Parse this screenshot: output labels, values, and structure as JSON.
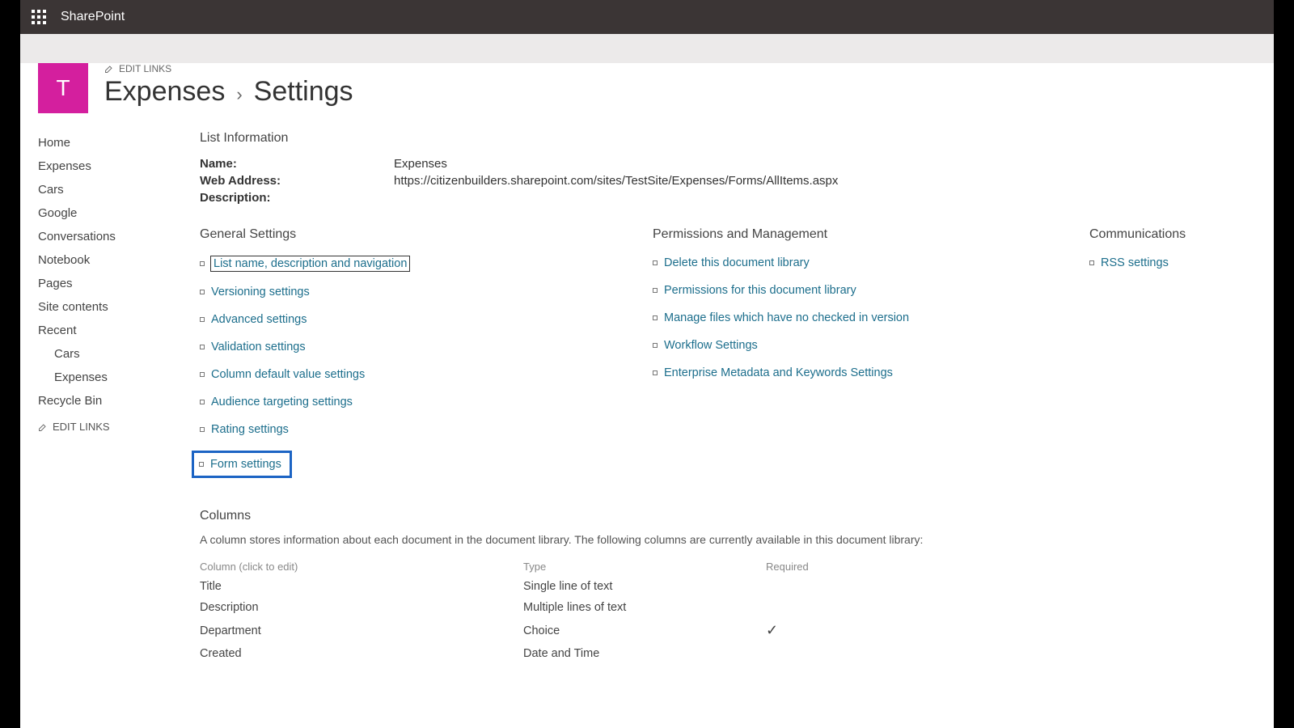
{
  "brand": "SharePoint",
  "site_tile": "T",
  "edit_links": "EDIT LINKS",
  "page_title_left": "Expenses",
  "page_title_sep": "›",
  "page_title_right": "Settings",
  "leftnav": {
    "home": "Home",
    "expenses": "Expenses",
    "cars": "Cars",
    "google": "Google",
    "conversations": "Conversations",
    "notebook": "Notebook",
    "pages": "Pages",
    "site_contents": "Site contents",
    "recent": "Recent",
    "recent_cars": "Cars",
    "recent_expenses": "Expenses",
    "recycle": "Recycle Bin",
    "editlinks": "EDIT LINKS"
  },
  "list_info": {
    "heading": "List Information",
    "name_label": "Name:",
    "name_value": "Expenses",
    "web_label": "Web Address:",
    "web_value": "https://citizenbuilders.sharepoint.com/sites/TestSite/Expenses/Forms/AllItems.aspx",
    "desc_label": "Description:",
    "desc_value": ""
  },
  "general": {
    "heading": "General Settings",
    "items": {
      "name_nav": "List name, description and navigation",
      "versioning": "Versioning settings",
      "advanced": "Advanced settings",
      "validation": "Validation settings",
      "coldefault": "Column default value settings",
      "audience": "Audience targeting settings",
      "rating": "Rating settings",
      "form": "Form settings"
    }
  },
  "perms": {
    "heading": "Permissions and Management",
    "items": {
      "delete": "Delete this document library",
      "perms": "Permissions for this document library",
      "manage": "Manage files which have no checked in version",
      "workflow": "Workflow Settings",
      "entmeta": "Enterprise Metadata and Keywords Settings"
    }
  },
  "comms": {
    "heading": "Communications",
    "items": {
      "rss": "RSS settings"
    }
  },
  "columns": {
    "heading": "Columns",
    "desc": "A column stores information about each document in the document library. The following columns are currently available in this document library:",
    "h_col": "Column (click to edit)",
    "h_type": "Type",
    "h_req": "Required",
    "rows": [
      {
        "name": "Title",
        "type": "Single line of text",
        "req": ""
      },
      {
        "name": "Description",
        "type": "Multiple lines of text",
        "req": ""
      },
      {
        "name": "Department",
        "type": "Choice",
        "req": "✓"
      },
      {
        "name": "Created",
        "type": "Date and Time",
        "req": ""
      }
    ]
  }
}
